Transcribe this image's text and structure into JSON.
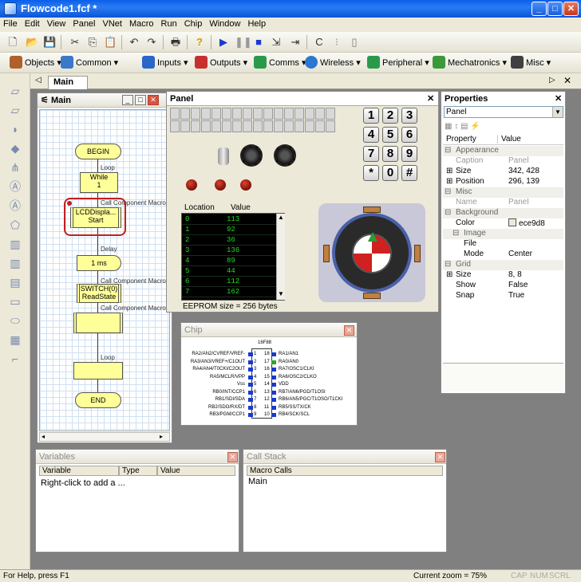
{
  "app": {
    "title": "Flowcode1.fcf *"
  },
  "menu": [
    "File",
    "Edit",
    "View",
    "Panel",
    "VNet",
    "Macro",
    "Run",
    "Chip",
    "Window",
    "Help"
  ],
  "component_toolbar": [
    {
      "label": "Objects",
      "color": "#b0602a"
    },
    {
      "label": "Common",
      "color": "#3a78c8"
    },
    {
      "label": "Inputs",
      "color": "#2a66c8"
    },
    {
      "label": "Outputs",
      "color": "#c83030"
    },
    {
      "label": "Comms",
      "color": "#2a9a4a"
    },
    {
      "label": "Wireless",
      "color": "#2a78d0"
    },
    {
      "label": "Peripheral",
      "color": "#2a9a4a"
    },
    {
      "label": "Mechatronics",
      "color": "#3a9a3a"
    },
    {
      "label": "Misc",
      "color": "#404040"
    }
  ],
  "doc_tab": "Main",
  "main_window": {
    "title": "Main",
    "blocks": {
      "begin": "BEGIN",
      "loop1": "Loop",
      "while": "While",
      "while_val": "1",
      "call1_label": "Call Component Macro",
      "call1_line1": "LCDDispla...",
      "call1_line2": "Start",
      "delay_label": "Delay",
      "delay": "1 ms",
      "call2_label": "Call Component Macro",
      "call2_line1": "SWITCH(0)",
      "call2_line2": "ReadState",
      "call3_label": "Call Component Macro",
      "loop2": "Loop",
      "end": "END"
    }
  },
  "panel": {
    "title": "Panel",
    "keypad": [
      "1",
      "2",
      "3",
      "4",
      "5",
      "6",
      "7",
      "8",
      "9",
      "*",
      "0",
      "#"
    ],
    "eeprom_headers": [
      "Location",
      "Value"
    ],
    "eeprom_rows": [
      [
        "0",
        "113"
      ],
      [
        "1",
        "92"
      ],
      [
        "2",
        "36"
      ],
      [
        "3",
        "136"
      ],
      [
        "4",
        "89"
      ],
      [
        "5",
        "44"
      ],
      [
        "6",
        "112"
      ],
      [
        "7",
        "162"
      ]
    ],
    "eeprom_size": "EEPROM size = 256 bytes"
  },
  "properties": {
    "title": "Properties",
    "selector": "Panel",
    "col_property": "Property",
    "col_value": "Value",
    "rows": [
      {
        "type": "group",
        "key": "Appearance"
      },
      {
        "type": "dim",
        "key": "Caption",
        "value": "Panel"
      },
      {
        "type": "item",
        "key": "Size",
        "value": "342, 428",
        "expand": true
      },
      {
        "type": "item",
        "key": "Position",
        "value": "296, 139",
        "expand": true
      },
      {
        "type": "group",
        "key": "Misc"
      },
      {
        "type": "dim",
        "key": "Name",
        "value": "Panel"
      },
      {
        "type": "group",
        "key": "Background"
      },
      {
        "type": "item",
        "key": "Color",
        "value": "ece9d8",
        "swatch": true
      },
      {
        "type": "subgroup",
        "key": "Image"
      },
      {
        "type": "item",
        "key": "File",
        "value": "",
        "indent": true
      },
      {
        "type": "item",
        "key": "Mode",
        "value": "Center",
        "indent": true
      },
      {
        "type": "group",
        "key": "Grid"
      },
      {
        "type": "item",
        "key": "Size",
        "value": "8, 8",
        "expand": true
      },
      {
        "type": "item",
        "key": "Show",
        "value": "False"
      },
      {
        "type": "item",
        "key": "Snap",
        "value": "True"
      }
    ]
  },
  "chip": {
    "title": "Chip",
    "name": "16F88",
    "left_pins": [
      [
        "RA2/AN2/CVREF/VREF-",
        "1"
      ],
      [
        "RA3/AN3/VREF+/C1OUT",
        "2"
      ],
      [
        "RA4/AN4/T0CKI/C2OUT",
        "3"
      ],
      [
        "RA5/MCLR/VPP",
        "4"
      ],
      [
        "Vss",
        "5"
      ],
      [
        "RB0/INT/CCP1",
        "6"
      ],
      [
        "RB1/SDI/SDA",
        "7"
      ],
      [
        "RB2/SDO/RX/DT",
        "8"
      ],
      [
        "RB3/PGM/CCP1",
        "9"
      ]
    ],
    "right_pins": [
      [
        "18",
        "RA1/AN1"
      ],
      [
        "17",
        "RA0/AN0"
      ],
      [
        "16",
        "RA7/OSC1/CLKI"
      ],
      [
        "15",
        "RA6/OSC2/CLKO"
      ],
      [
        "14",
        "VDD"
      ],
      [
        "13",
        "RB7/AN6/PGD/T1OSI"
      ],
      [
        "12",
        "RB6/AN5/PGC/T1OSO/T1CKI"
      ],
      [
        "11",
        "RB5/SS/TX/CK"
      ],
      [
        "10",
        "RB4/SCK/SCL"
      ]
    ]
  },
  "variables": {
    "title": "Variables",
    "headers": [
      "Variable",
      "Type",
      "Value"
    ],
    "hint": "Right-click to add a ..."
  },
  "callstack": {
    "title": "Call Stack",
    "header": "Macro Calls",
    "item": "Main"
  },
  "status": {
    "help": "For Help, press F1",
    "zoom": "Current zoom = 75%",
    "caps": "CAP",
    "num": "NUM",
    "scrl": "SCRL"
  }
}
